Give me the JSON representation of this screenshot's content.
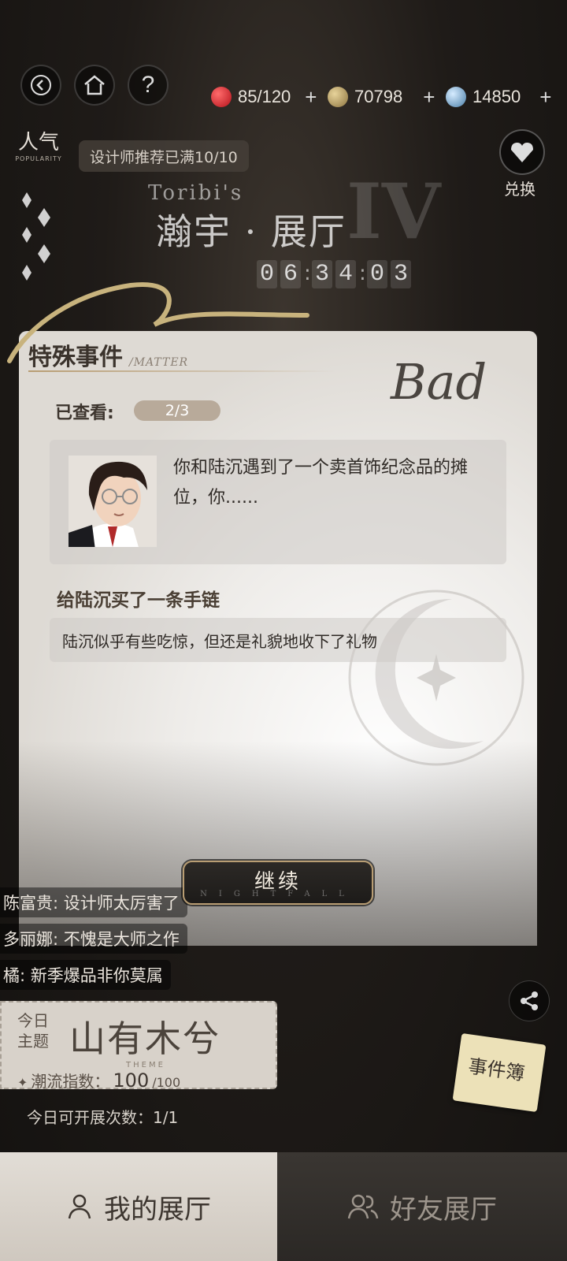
{
  "header": {
    "resources": [
      {
        "name": "stamina",
        "value": "85/120",
        "color": "#c8232b"
      },
      {
        "name": "gold-coins",
        "value": "70798",
        "color": "#b69a5a"
      },
      {
        "name": "diamonds",
        "value": "14850",
        "color": "#6aa6d8"
      }
    ],
    "plus_label": "+",
    "help_label": "?"
  },
  "popularity": {
    "label_cn": "人气",
    "label_en": "POPULARITY"
  },
  "designer_pill": "设计师推荐已满10/10",
  "exchange": {
    "label": "兑换"
  },
  "hall": {
    "title_en": "Toribi's",
    "title_cn": "瀚宇 · 展厅",
    "roman": "IV",
    "timer": [
      "0",
      "6",
      "3",
      "4",
      "0",
      "3"
    ]
  },
  "event_card": {
    "title_cn": "特殊事件",
    "title_en": "/MATTER",
    "checked_label": "已查看:",
    "checked_value": "2/3",
    "stamp": "Bad",
    "story": "你和陆沉遇到了一个卖首饰纪念品的摊位，你......",
    "choice": "给陆沉买了一条手链",
    "result": "陆沉似乎有些吃惊，但还是礼貌地收下了礼物"
  },
  "continue_button": {
    "label": "继续",
    "sub": "NIGHTFALL"
  },
  "comments": [
    "陈富贵: 设计师太厉害了",
    "多丽娜: 不愧是大师之作",
    "橘: 新季爆品非你莫属"
  ],
  "theme": {
    "tag": "今日主题",
    "name": "山有木兮",
    "en": "THEME",
    "trend_label": "潮流指数：",
    "trend_value": "100",
    "trend_max": "/100",
    "today_count": "今日可开展次数：1/1"
  },
  "notebook": {
    "label": "事件簿"
  },
  "tabs": [
    {
      "label": "我的展厅",
      "active": true
    },
    {
      "label": "好友展厅",
      "active": false
    }
  ]
}
